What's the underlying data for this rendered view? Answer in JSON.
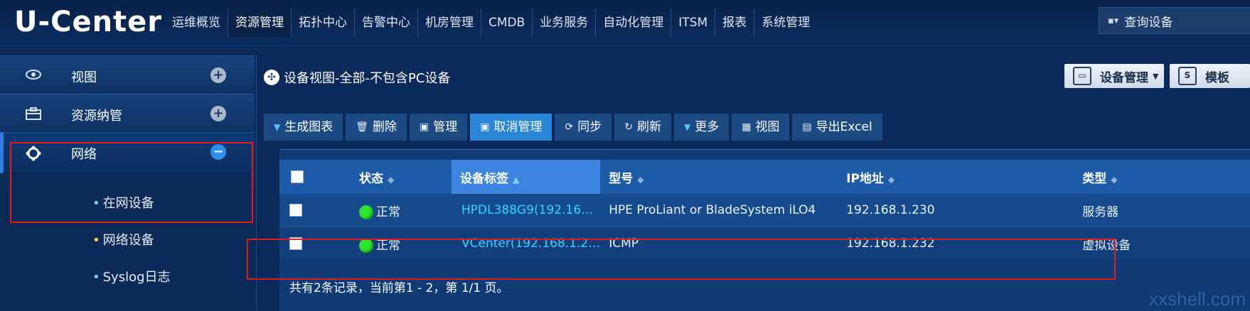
{
  "app": {
    "logo": "U-Center"
  },
  "nav": [
    {
      "label": "运维概览",
      "active": false
    },
    {
      "label": "资源管理",
      "active": true
    },
    {
      "label": "拓扑中心",
      "active": false
    },
    {
      "label": "告警中心",
      "active": false
    },
    {
      "label": "机房管理",
      "active": false
    },
    {
      "label": "CMDB",
      "active": false
    },
    {
      "label": "业务服务",
      "active": false
    },
    {
      "label": "自动化管理",
      "active": false
    },
    {
      "label": "ITSM",
      "active": false
    },
    {
      "label": "报表",
      "active": false
    },
    {
      "label": "系统管理",
      "active": false
    }
  ],
  "search": {
    "label": "查询设备"
  },
  "sidebar": {
    "items": [
      {
        "label": "视图",
        "toggle": "+"
      },
      {
        "label": "资源纳管",
        "toggle": "+"
      },
      {
        "label": "网络",
        "toggle": "−"
      }
    ],
    "sub_items": [
      {
        "label": "在网设备"
      },
      {
        "label": "网络设备"
      },
      {
        "label": "Syslog日志"
      }
    ]
  },
  "main": {
    "title": "设备视图-全部-不包含PC设备",
    "tabs": [
      {
        "label": "设备管理"
      },
      {
        "label": "模板"
      }
    ],
    "toolbar": [
      {
        "label": "生成图表"
      },
      {
        "label": "删除"
      },
      {
        "label": "管理"
      },
      {
        "label": "取消管理"
      },
      {
        "label": "同步"
      },
      {
        "label": "刷新"
      },
      {
        "label": "更多"
      },
      {
        "label": "视图"
      },
      {
        "label": "导出Excel"
      }
    ]
  },
  "table": {
    "columns": [
      "状态",
      "设备标签",
      "型号",
      "IP地址",
      "类型"
    ],
    "rows": [
      {
        "status": "正常",
        "tag": "HPDL388G9(192.16…",
        "model": "HPE ProLiant or BladeSystem iLO4",
        "ip": "192.168.1.230",
        "type": "服务器"
      },
      {
        "status": "正常",
        "tag": "VCenter(192.168.1.2…",
        "model": "ICMP",
        "ip": "192.168.1.232",
        "type": "虚拟设备"
      }
    ],
    "footer": "共有2条记录，当前第1 - 2，第 1/1 页。"
  },
  "watermark": "xxshell.com",
  "colors": {
    "accent": "#2a86d6",
    "status_ok": "#2ee62e",
    "highlight_box": "#e01c1c",
    "tag_link": "#33d6ff"
  }
}
